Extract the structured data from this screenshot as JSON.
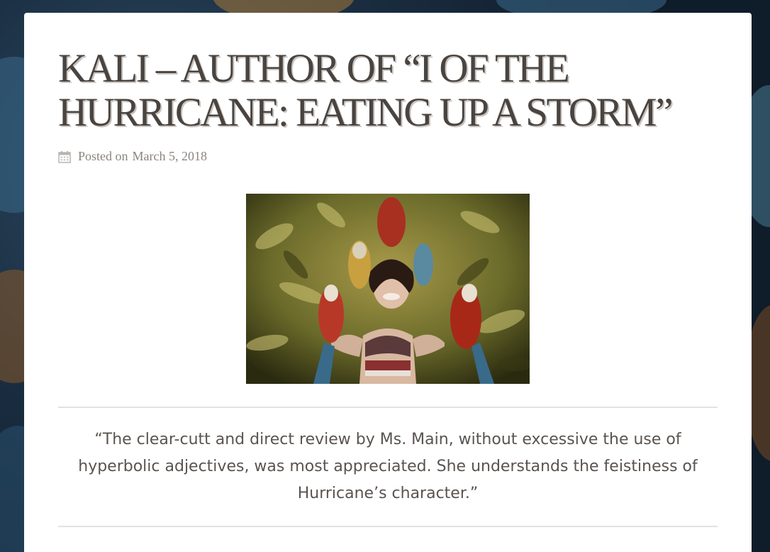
{
  "post": {
    "title": "KALI – AUTHOR OF “I OF THE HURRICANE: EATING UP A STORM”",
    "meta_prefix": "Posted on",
    "meta_date": "March 5, 2018",
    "meta_icon": "calendar-icon",
    "featured_image_alt": "Woman smiling with macaws perched on her head and arms among tropical plants",
    "quote": "“The clear-cutt and direct review by Ms. Main, without excessive the use of hyperbolic adjectives, was most appreciated. She understands the feistiness of Hurricane’s character.”"
  },
  "colors": {
    "title": "#4a4440",
    "meta": "#8a8580",
    "divider": "#e2e2e2",
    "quote": "#5a5450",
    "background": "#1a2d40"
  }
}
